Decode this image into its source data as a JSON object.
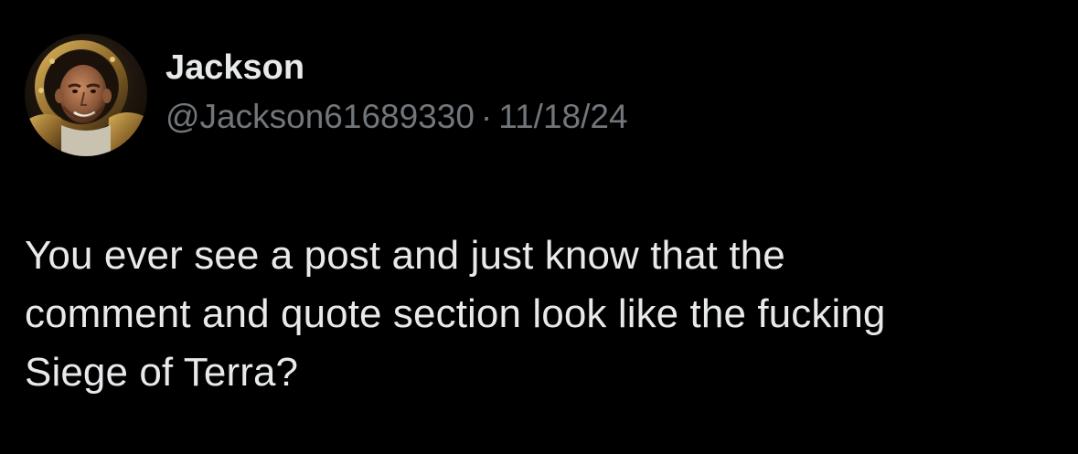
{
  "tweet": {
    "author": {
      "display_name": "Jackson",
      "handle": "@Jackson61689330",
      "avatar_icon": "profile-avatar"
    },
    "separator": "·",
    "date": "11/18/24",
    "text_lines": [
      "You ever see a post and just know that the",
      "comment and quote section look like the fucking",
      "Siege of Terra?"
    ]
  },
  "colors": {
    "background": "#000000",
    "primary_text": "#e7e9ea",
    "secondary_text": "#71767b"
  }
}
